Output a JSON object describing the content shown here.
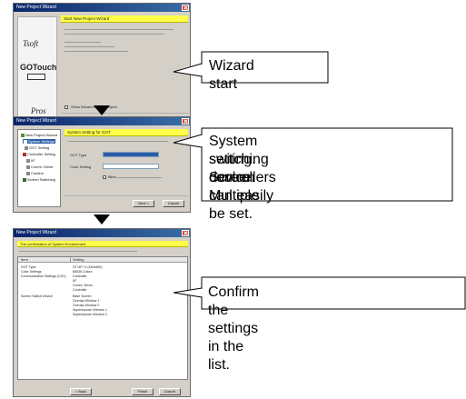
{
  "callouts": {
    "step1": "Wizard start",
    "step2_lines": [
      "System setting. Screen",
      "switching device. Multiple",
      "controllers can easily be set."
    ],
    "step3": "Confirm the settings in the list."
  },
  "window1": {
    "title": "New Project Wizard",
    "banner": "Start New Project Wizard",
    "logos": {
      "gt_top": "Tsoft",
      "gotouch": "GOTouch",
      "gt_bottom": "Pros"
    },
    "checkbox_label": "Show Wizard at New Project",
    "buttons": {
      "next": "Next >",
      "cancel": "Cancel"
    }
  },
  "window2": {
    "title": "New Project Wizard",
    "banner": "System Setting for GOT",
    "tree": [
      "New Project Wizard",
      "System Settings",
      "GOT Setting",
      "Controller Setting",
      "I/F",
      "Comm. Driver",
      "Confirm",
      "Screen Switching"
    ],
    "labels": {
      "got_type": "GOT Type",
      "color_setting": "Color Setting"
    },
    "checkbox_label": "Blink",
    "buttons": {
      "back": "< Back",
      "next": "Next >",
      "cancel": "Cancel"
    }
  },
  "window3": {
    "title": "New Project Wizard",
    "banner": "The confirmation of System Environment",
    "header_cols": [
      "Item",
      "Setting"
    ],
    "rows": [
      [
        "GOT Type",
        "GT16**-V (640x480)"
      ],
      [
        "Color Settings",
        "65536 Colors"
      ],
      [
        "Communication Settings (CH1)",
        "Controller"
      ],
      [
        "",
        "I/F"
      ],
      [
        "",
        "Comm. Driver"
      ],
      [
        "",
        "Controller"
      ],
      [
        "Screen Switch Device",
        "Base Screen"
      ],
      [
        "",
        "Overlap Window 1"
      ],
      [
        "",
        "Overlap Window 2"
      ],
      [
        "",
        "Superimpose Window 1"
      ],
      [
        "",
        "Superimpose Window 2"
      ]
    ],
    "buttons": {
      "back": "< Back",
      "finish": "Finish",
      "cancel": "Cancel"
    }
  }
}
